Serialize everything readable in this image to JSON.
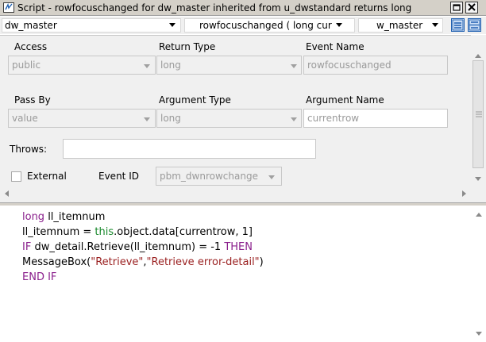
{
  "window": {
    "title": "Script - rowfocuschanged for dw_master inherited from u_dwstandard returns long",
    "restore_icon": "restore-icon",
    "close_icon": "close-icon"
  },
  "selectors": {
    "object": "dw_master",
    "event": "rowfocuschanged ( long cur",
    "ancestor": "w_master"
  },
  "properties": {
    "access_label": "Access",
    "access_value": "public",
    "return_type_label": "Return Type",
    "return_type_value": "long",
    "event_name_label": "Event Name",
    "event_name_value": "rowfocuschanged",
    "pass_by_label": "Pass By",
    "pass_by_value": "value",
    "argument_type_label": "Argument Type",
    "argument_type_value": "long",
    "argument_name_label": "Argument Name",
    "argument_name_value": "currentrow",
    "throws_label": "Throws:",
    "throws_value": "",
    "external_label": "External",
    "external_checked": false,
    "event_id_label": "Event ID",
    "event_id_value": "pbm_dwnrowchange"
  },
  "code": {
    "line1_kw": "long",
    "line1_rest": " ll_itemnum",
    "line2_a": "ll_itemnum = ",
    "line2_kw": "this",
    "line2_b": ".object.data[currentrow, 1]",
    "line3_kw1": "IF",
    "line3_a": " dw_detail.Retrieve(ll_itemnum) = -1 ",
    "line3_kw2": "THEN",
    "line4_a": "    MessageBox(",
    "line4_s1": "\"Retrieve\"",
    "line4_comma": ",",
    "line4_s2": "\"Retrieve error-detail\"",
    "line4_b": ")",
    "line5_kw": "END IF"
  },
  "colors": {
    "keyword": "#8a1f8c",
    "pronoun": "#1b8a2e",
    "string": "#9a1f1f",
    "accent": "#1f5fb0"
  }
}
